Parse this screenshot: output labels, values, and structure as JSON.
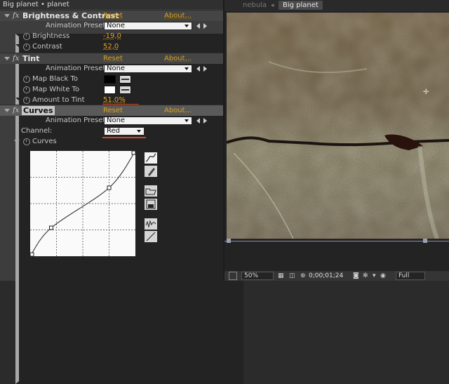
{
  "breadcrumb": "Big planet • planet",
  "effects": {
    "brightness_contrast": {
      "fx": "fx",
      "title": "Brightness & Contrast",
      "reset": "Reset",
      "about": "About...",
      "presets_label": "Animation Presets:",
      "presets_value": "None",
      "brightness_label": "Brightness",
      "brightness_value": "-19,0",
      "contrast_label": "Contrast",
      "contrast_value": "52,0"
    },
    "tint": {
      "fx": "fx",
      "title": "Tint",
      "reset": "Reset",
      "about": "About...",
      "presets_label": "Animation Presets:",
      "presets_value": "None",
      "map_black_label": "Map Black To",
      "map_black_color": "#000000",
      "map_white_label": "Map White To",
      "map_white_color": "#ffffff",
      "amount_label": "Amount to Tint",
      "amount_value": "51,0%"
    },
    "curves": {
      "fx": "fx",
      "title": "Curves",
      "reset": "Reset",
      "about": "About...",
      "presets_label": "Animation Presets:",
      "presets_value": "None",
      "channel_label": "Channel:",
      "channel_value": "Red",
      "curves_label": "Curves",
      "curve_points": [
        [
          0,
          0
        ],
        [
          0.2,
          0.27
        ],
        [
          0.75,
          0.65
        ],
        [
          1,
          1
        ]
      ]
    }
  },
  "viewer": {
    "tabs": [
      "nebula",
      "Big planet"
    ],
    "active_tab": "Big planet",
    "zoom": "50%",
    "timecode": "0;00;01;24",
    "resolution": "Full"
  },
  "colors": {
    "accent": "#d9a21d",
    "annotation": "#d2451e",
    "panel": "#3d3d3d"
  }
}
